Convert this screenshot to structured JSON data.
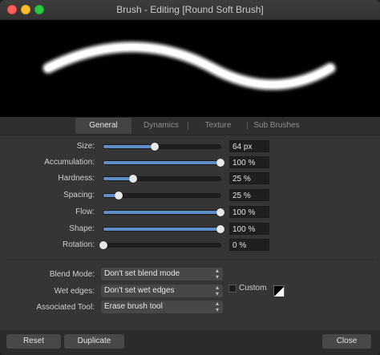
{
  "window": {
    "title": "Brush - Editing [Round Soft Brush]"
  },
  "tabs": [
    {
      "label": "General",
      "active": true
    },
    {
      "label": "Dynamics",
      "active": false
    },
    {
      "label": "Texture",
      "active": false
    },
    {
      "label": "Sub Brushes",
      "active": false
    }
  ],
  "sliders": [
    {
      "label": "Size:",
      "value": "64 px",
      "fraction": 0.44
    },
    {
      "label": "Accumulation:",
      "value": "100 %",
      "fraction": 1.0
    },
    {
      "label": "Hardness:",
      "value": "25 %",
      "fraction": 0.25
    },
    {
      "label": "Spacing:",
      "value": "25 %",
      "fraction": 0.13
    },
    {
      "label": "Flow:",
      "value": "100 %",
      "fraction": 1.0
    },
    {
      "label": "Shape:",
      "value": "100 %",
      "fraction": 1.0
    },
    {
      "label": "Rotation:",
      "value": "0 %",
      "fraction": 0.0
    }
  ],
  "dropdowns": {
    "blend_mode": {
      "label": "Blend Mode:",
      "value": "Don't set blend mode"
    },
    "wet_edges": {
      "label": "Wet edges:",
      "value": "Don't set wet edges"
    },
    "associated_tool": {
      "label": "Associated Tool:",
      "value": "Erase brush tool"
    }
  },
  "custom": {
    "label": "Custom",
    "checked": false
  },
  "buttons": {
    "reset": "Reset",
    "duplicate": "Duplicate",
    "close": "Close"
  },
  "colors": {
    "accent": "#5f8fc9",
    "stroke": "#ffffff"
  }
}
